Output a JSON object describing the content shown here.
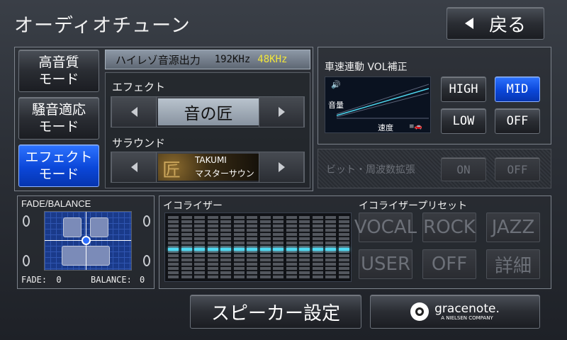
{
  "header": {
    "title": "オーディオチューン",
    "back_label": "戻る"
  },
  "modes": [
    {
      "line1": "高音質",
      "line2": "モード",
      "active": false
    },
    {
      "line1": "騒音適応",
      "line2": "モード",
      "active": false
    },
    {
      "line1": "エフェクト",
      "line2": "モード",
      "active": true
    }
  ],
  "hires": {
    "label": "ハイレゾ音源出力",
    "rate1": "192KHz",
    "rate2": "48KHz",
    "rate2_color": "#f2e63a"
  },
  "effect": {
    "label": "エフェクト",
    "value": "音の匠"
  },
  "surround": {
    "label": "サラウンド",
    "logo_top": "TAKUMI",
    "logo_bottom": "マスターサウンド"
  },
  "speed_vol": {
    "title": "車速連動 VOL補正",
    "graph_ylabel": "音量",
    "graph_xlabel": "速度",
    "options": [
      {
        "label": "HIGH",
        "active": false
      },
      {
        "label": "MID",
        "active": true
      },
      {
        "label": "LOW",
        "active": false
      },
      {
        "label": "OFF",
        "active": false
      }
    ]
  },
  "bit_expand": {
    "label": "ビット・周波数拡張",
    "on_label": "ON",
    "off_label": "OFF"
  },
  "fade_balance": {
    "title": "FADE/BALANCE",
    "fade_label": "FADE:",
    "fade_value": "0",
    "balance_label": "BALANCE:",
    "balance_value": "0"
  },
  "equalizer": {
    "title": "イコライザー",
    "bands": 14,
    "levels": [
      0,
      0,
      0,
      0,
      0,
      0,
      0,
      0,
      0,
      0,
      0,
      0,
      0,
      0
    ]
  },
  "eq_presets": {
    "title": "イコライザープリセット",
    "items": [
      "VOCAL",
      "ROCK",
      "JAZZ",
      "USER",
      "OFF",
      "詳細"
    ]
  },
  "footer": {
    "speaker_label": "スピーカー設定",
    "gracenote_name": "gracenote.",
    "gracenote_sub": "A NIELSEN COMPANY"
  },
  "colors": {
    "accent_blue": "#0b47d9",
    "eq_line": "#4fd8f0"
  }
}
